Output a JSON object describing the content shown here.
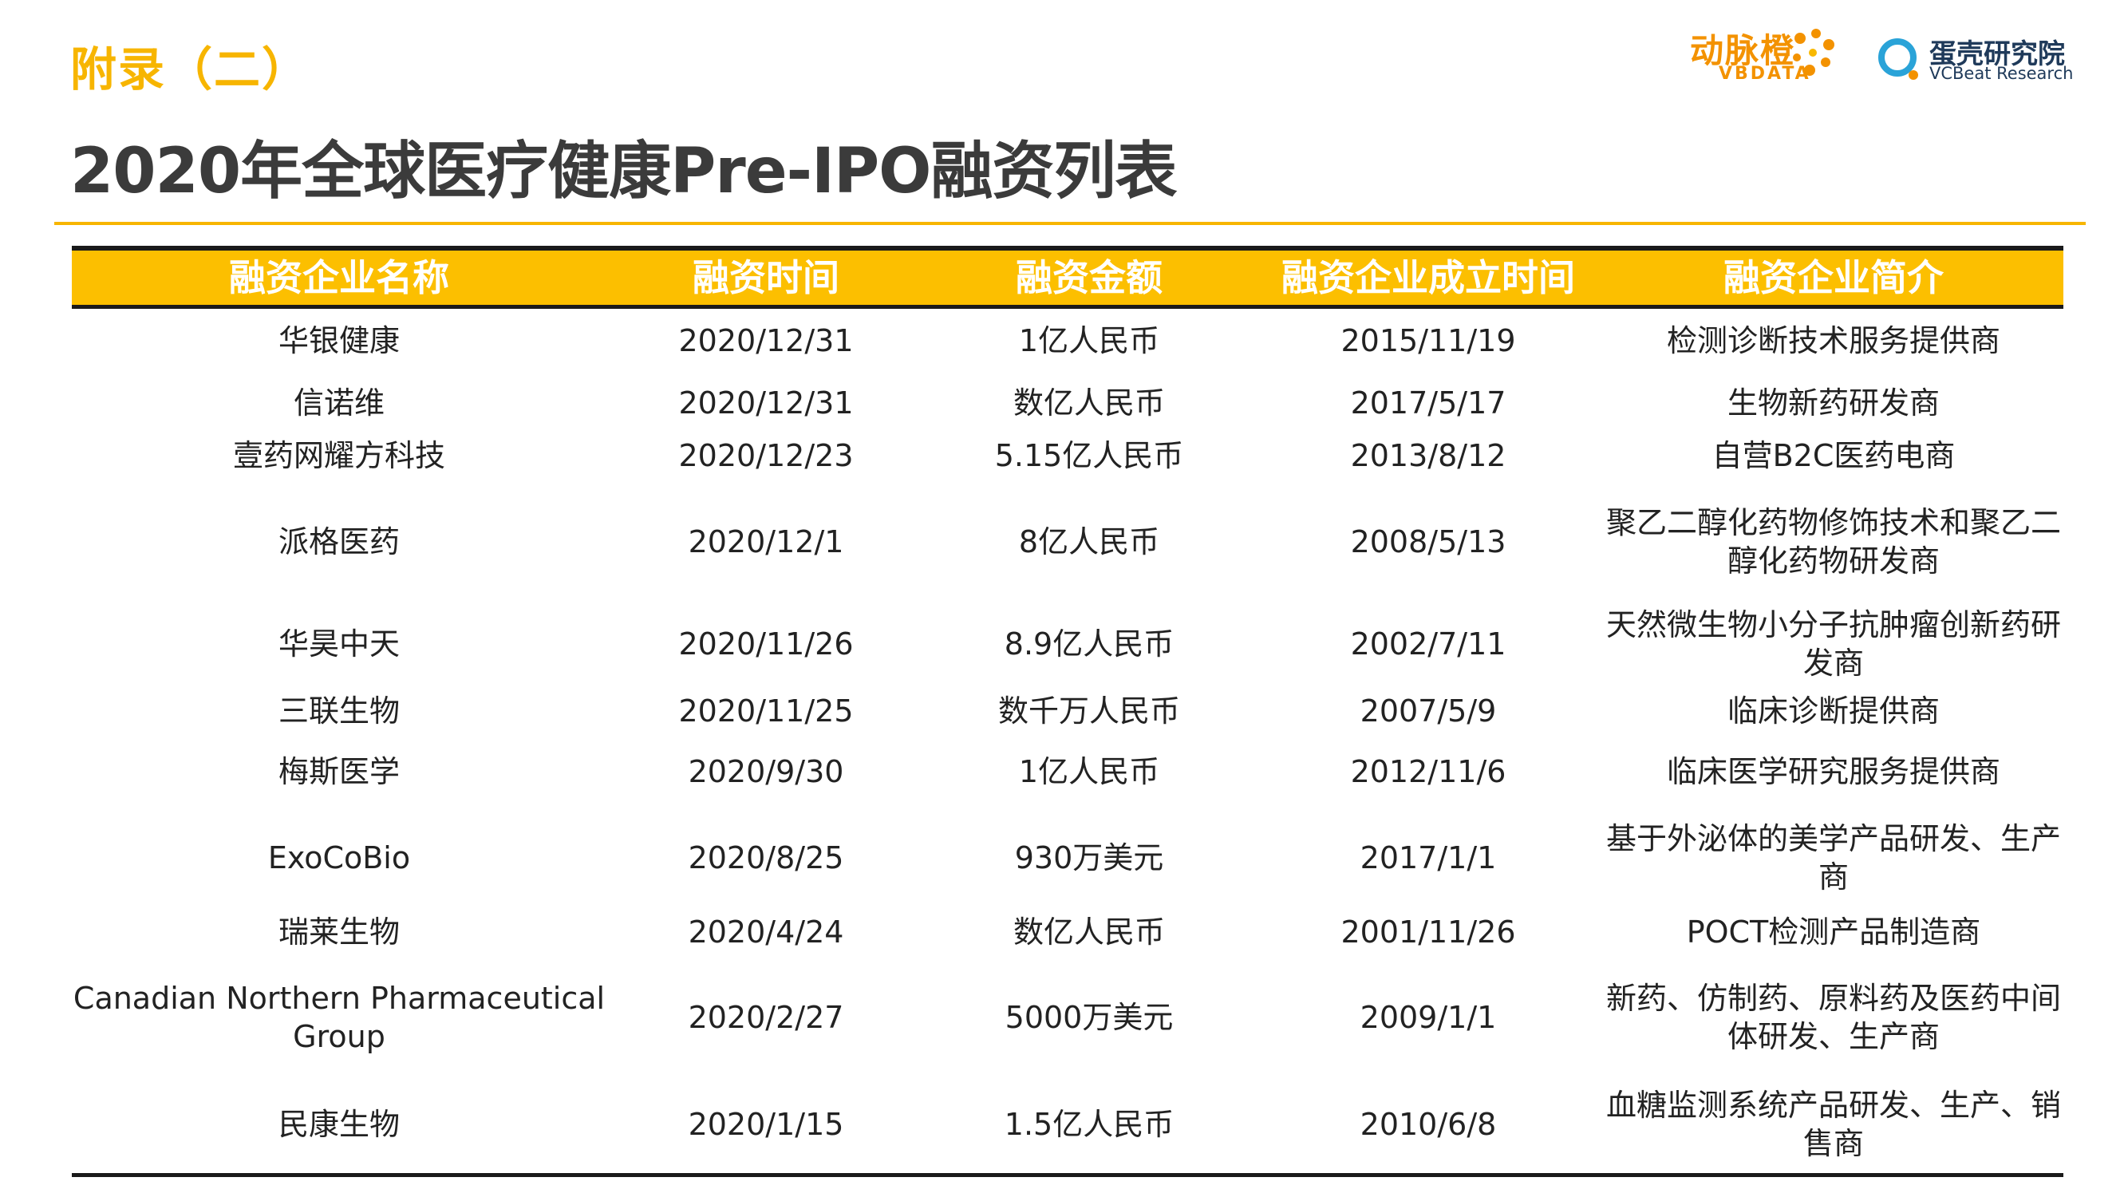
{
  "header": {
    "appendix_label": "附录（二）",
    "title": "2020年全球医疗健康Pre-IPO融资列表",
    "logo_vbdata_cn": "动脉橙",
    "logo_vbdata_en": "VBDATA",
    "logo_vcbeat_cn": "蛋壳研究院",
    "logo_vcbeat_en": "VCBeat Research"
  },
  "colors": {
    "accent": "#fcbf00",
    "title_text": "#3b3b3b",
    "logo_orange": "#f39200",
    "logo_navy": "#1f3a5a"
  },
  "table": {
    "columns": [
      "融资企业名称",
      "融资时间",
      "融资金额",
      "融资企业成立时间",
      "融资企业简介"
    ],
    "rows": [
      {
        "name": "华银健康",
        "date": "2020/12/31",
        "amount": "1亿人民币",
        "founded": "2015/11/19",
        "intro": "检测诊断技术服务提供商"
      },
      {
        "name": "信诺维",
        "date": "2020/12/31",
        "amount": "数亿人民币",
        "founded": "2017/5/17",
        "intro": "生物新药研发商"
      },
      {
        "name": "壹药网耀方科技",
        "date": "2020/12/23",
        "amount": "5.15亿人民币",
        "founded": "2013/8/12",
        "intro": "自营B2C医药电商"
      },
      {
        "name": "派格医药",
        "date": "2020/12/1",
        "amount": "8亿人民币",
        "founded": "2008/5/13",
        "intro": "聚乙二醇化药物修饰技术和聚乙二醇化药物研发商"
      },
      {
        "name": "华昊中天",
        "date": "2020/11/26",
        "amount": "8.9亿人民币",
        "founded": "2002/7/11",
        "intro": "天然微生物小分子抗肿瘤创新药研发商"
      },
      {
        "name": "三联生物",
        "date": "2020/11/25",
        "amount": "数千万人民币",
        "founded": "2007/5/9",
        "intro": "临床诊断提供商"
      },
      {
        "name": "梅斯医学",
        "date": "2020/9/30",
        "amount": "1亿人民币",
        "founded": "2012/11/6",
        "intro": "临床医学研究服务提供商"
      },
      {
        "name": "ExoCoBio",
        "date": "2020/8/25",
        "amount": "930万美元",
        "founded": "2017/1/1",
        "intro": "基于外泌体的美学产品研发、生产商"
      },
      {
        "name": "瑞莱生物",
        "date": "2020/4/24",
        "amount": "数亿人民币",
        "founded": "2001/11/26",
        "intro": "POCT检测产品制造商"
      },
      {
        "name": "Canadian Northern Pharmaceutical Group",
        "date": "2020/2/27",
        "amount": "5000万美元",
        "founded": "2009/1/1",
        "intro": "新药、仿制药、原料药及医药中间体研发、生产商"
      },
      {
        "name": "民康生物",
        "date": "2020/1/15",
        "amount": "1.5亿人民币",
        "founded": "2010/6/8",
        "intro": "血糖监测系统产品研发、生产、销售商"
      }
    ]
  }
}
